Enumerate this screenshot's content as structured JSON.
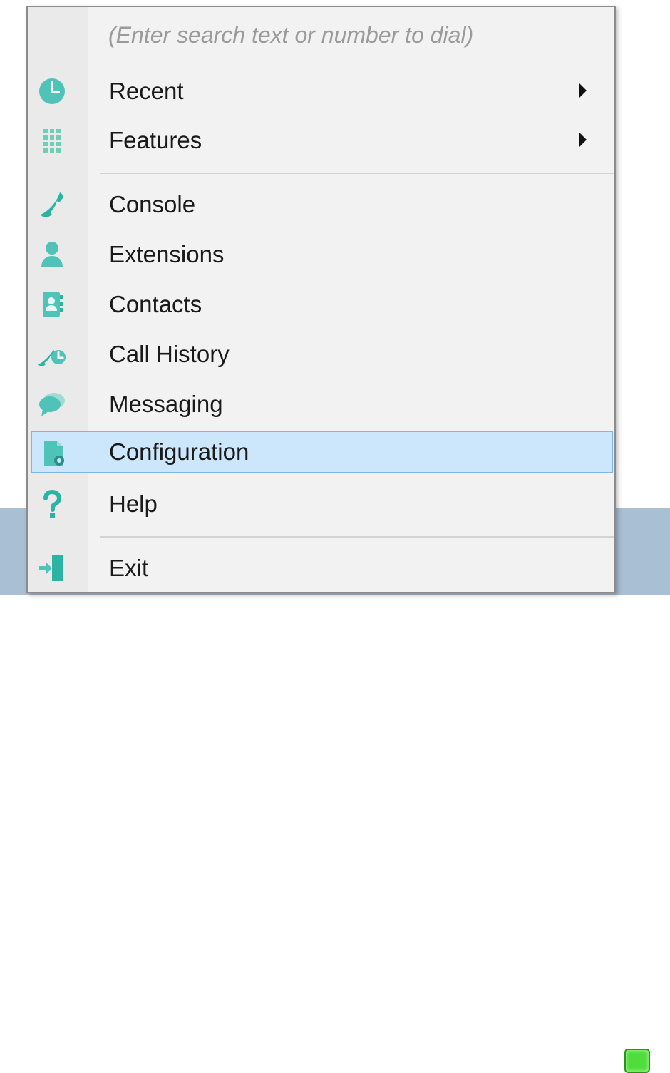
{
  "colors": {
    "icon_teal": "#4fc3b8",
    "selection_fill": "#cce6fb",
    "selection_border": "#7fb6ea",
    "taskbar": "#a9bfd4",
    "tray_green": "#4fdc3c"
  },
  "search": {
    "placeholder": "(Enter search text or number to dial)"
  },
  "menu": {
    "items": [
      {
        "label": "Recent",
        "icon": "clock-icon",
        "has_submenu": true
      },
      {
        "label": "Features",
        "icon": "keypad-grid-icon",
        "has_submenu": true
      },
      {
        "label": "Console",
        "icon": "phone-handset-icon",
        "has_submenu": false
      },
      {
        "label": "Extensions",
        "icon": "person-icon",
        "has_submenu": false
      },
      {
        "label": "Contacts",
        "icon": "address-book-icon",
        "has_submenu": false
      },
      {
        "label": "Call History",
        "icon": "phone-clock-icon",
        "has_submenu": false
      },
      {
        "label": "Messaging",
        "icon": "chat-bubble-icon",
        "has_submenu": false
      },
      {
        "label": "Configuration",
        "icon": "document-gear-icon",
        "has_submenu": false,
        "selected": true
      },
      {
        "label": "Help",
        "icon": "question-mark-icon",
        "has_submenu": false
      },
      {
        "label": "Exit",
        "icon": "exit-door-icon",
        "has_submenu": false
      }
    ]
  }
}
